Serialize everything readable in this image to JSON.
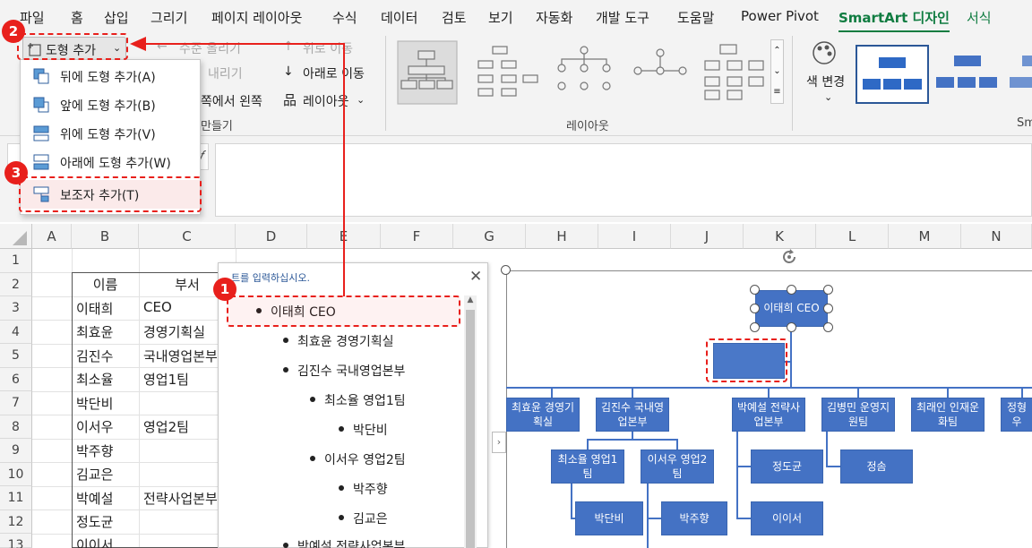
{
  "tabs": [
    "파일",
    "홈",
    "삽입",
    "그리기",
    "페이지 레이아웃",
    "수식",
    "데이터",
    "검토",
    "보기",
    "자동화",
    "개발 도구",
    "도움말",
    "Power Pivot",
    "SmartArt 디자인",
    "서식"
  ],
  "ribbon": {
    "add_shape": "도형 추가",
    "promote": "수준 올리기",
    "demote": "내리기",
    "move_up": "위로 이동",
    "move_down": "아래로 이동",
    "rtl": "쪽에서 왼쪽",
    "layout_btn": "레이아웃",
    "create_group": "만들기",
    "layouts_group": "레이아웃",
    "change_colors": "색 변경",
    "styles_group_partial": "Sm"
  },
  "menu": [
    {
      "label": "뒤에 도형 추가(A)",
      "icon": "shape-after-icon"
    },
    {
      "label": "앞에 도형 추가(B)",
      "icon": "shape-before-icon"
    },
    {
      "label": "위에 도형 추가(V)",
      "icon": "shape-above-icon"
    },
    {
      "label": "아래에 도형 추가(W)",
      "icon": "shape-below-icon"
    },
    {
      "label": "보조자 추가(T)",
      "icon": "assistant-icon"
    }
  ],
  "columns": [
    "A",
    "B",
    "C",
    "D",
    "E",
    "F",
    "G",
    "H",
    "I",
    "J",
    "K",
    "L",
    "M",
    "N"
  ],
  "rows": [
    "1",
    "2",
    "3",
    "4",
    "5",
    "6",
    "7",
    "8",
    "9",
    "10",
    "11",
    "12",
    "13"
  ],
  "cells": {
    "b2": "이름",
    "c2": "부서",
    "b3": "이태희",
    "c3": "CEO",
    "b4": "최효윤",
    "c4": "경영기획실",
    "b5": "김진수",
    "c5": "국내영업본부",
    "b6": "최소율",
    "c6": "영업1팀",
    "b7": "박단비",
    "c7": "",
    "b8": "이서우",
    "c8": "영업2팀",
    "b9": "박주향",
    "c9": "",
    "b10": "김교은",
    "c10": "",
    "b11": "박예설",
    "c11": "전략사업본부",
    "b12": "정도균",
    "c12": "",
    "b13": "이이서",
    "c13": ""
  },
  "textpane": {
    "title": "트를 입력하십시오.",
    "items": [
      "이태희 CEO",
      "최효윤 경영기획실",
      "김진수 국내영업본부",
      "최소율 영업1팀",
      "박단비",
      "이서우 영업2팀",
      "박주향",
      "김교은",
      "박예설 전략사업본부"
    ]
  },
  "smartart": {
    "ceo": "이태희 CEO",
    "level2": [
      "최효윤 경영기획실",
      "김진수 국내영업본부",
      "박예설 전략사업본부",
      "김병민 운영지원팀",
      "최래인 인재운화팀",
      "정형우"
    ],
    "level3a": [
      "최소율 영업1팀",
      "이서우 영업2팀"
    ],
    "level3b": [
      "정도균",
      "이이서"
    ],
    "level3c": [
      "정솜"
    ],
    "level4": [
      "박단비",
      "박주향"
    ]
  },
  "badges": [
    "1",
    "2",
    "3"
  ],
  "colors": {
    "accent": "#107c41",
    "callout": "#e8201c",
    "shape": "#4472c4"
  }
}
